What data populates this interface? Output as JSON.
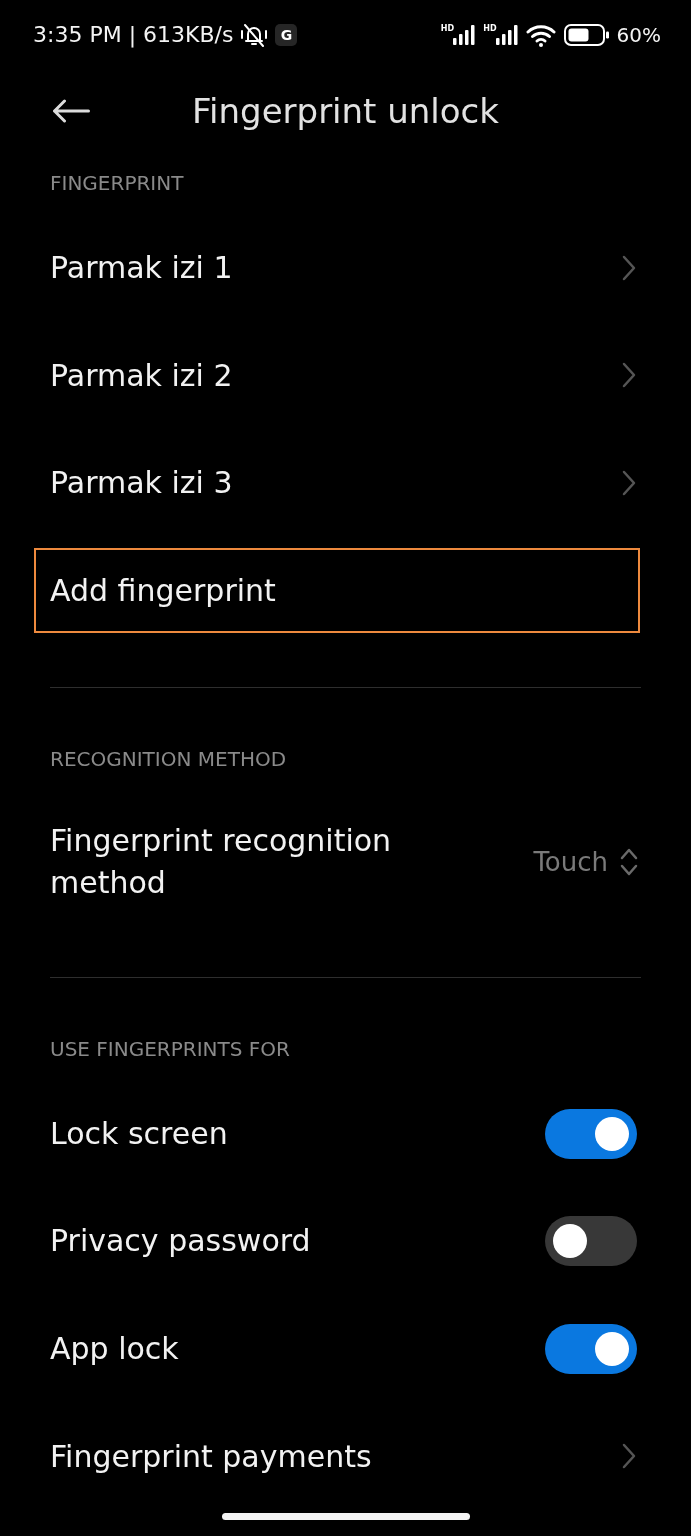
{
  "status_bar": {
    "status_text": "3:35 PM | 613KB/s",
    "notification_badge": "G",
    "network_labels": [
      "HD",
      "HD"
    ],
    "battery_text": "60%"
  },
  "header": {
    "title": "Fingerprint unlock"
  },
  "sections": [
    {
      "heading": "FINGERPRINT",
      "items": [
        {
          "kind": "link",
          "label": "Parmak izi 1",
          "highlighted": false
        },
        {
          "kind": "link",
          "label": "Parmak izi 2",
          "highlighted": false
        },
        {
          "kind": "link",
          "label": "Parmak izi 3",
          "highlighted": false
        },
        {
          "kind": "action",
          "label": "Add fingerprint",
          "highlighted": true
        }
      ]
    },
    {
      "heading": "RECOGNITION METHOD",
      "items": [
        {
          "kind": "select",
          "label": "Fingerprint recognition method",
          "value": "Touch"
        }
      ]
    },
    {
      "heading": "USE FINGERPRINTS FOR",
      "items": [
        {
          "kind": "toggle",
          "label": "Lock screen",
          "on": true
        },
        {
          "kind": "toggle",
          "label": "Privacy password",
          "on": false
        },
        {
          "kind": "toggle",
          "label": "App lock",
          "on": true
        },
        {
          "kind": "link",
          "label": "Fingerprint payments"
        }
      ]
    }
  ]
}
